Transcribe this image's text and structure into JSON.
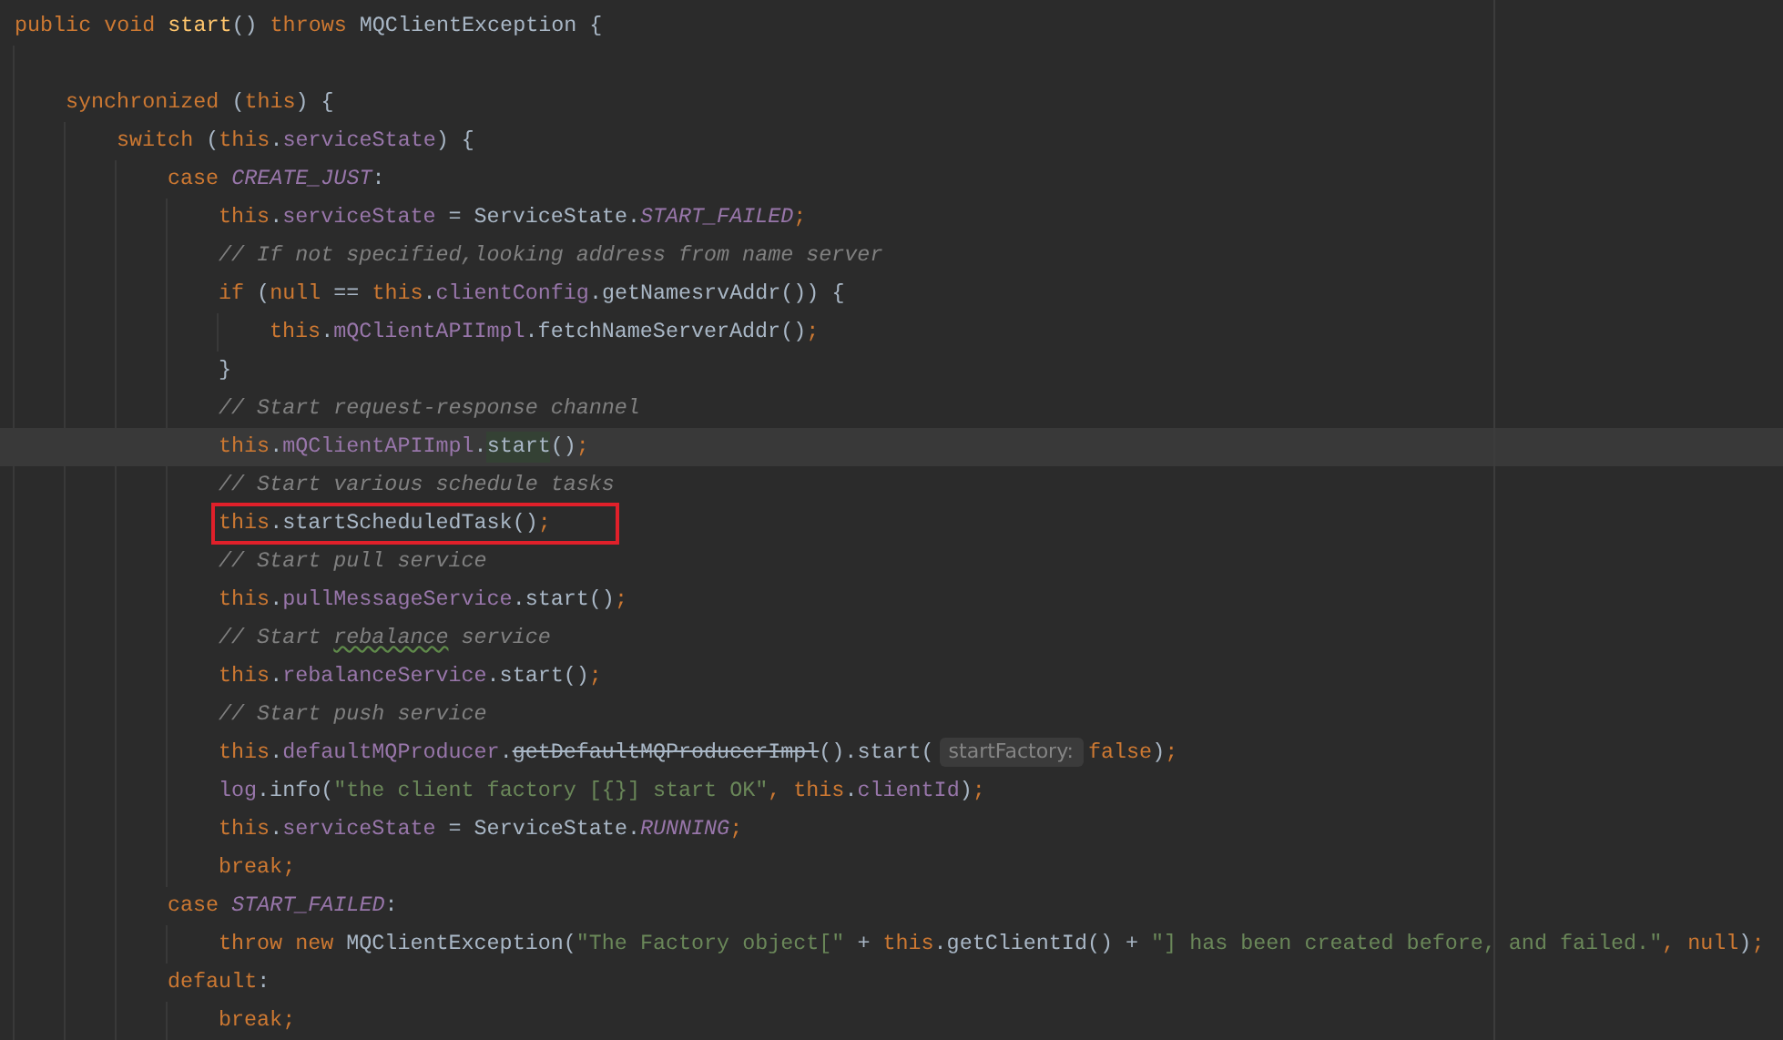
{
  "editor": {
    "lines": [
      {
        "tokens": [
          {
            "kind": "keyword",
            "text": "public void "
          },
          {
            "kind": "declaration",
            "text": "start"
          },
          {
            "kind": "plain",
            "text": "() "
          },
          {
            "kind": "keyword",
            "text": "throws "
          },
          {
            "kind": "plain",
            "text": "MQClientException {"
          }
        ],
        "children": [
          {
            "tokens": [
              {
                "kind": "keyword",
                "text": "synchronized "
              },
              {
                "kind": "plain",
                "text": "("
              },
              {
                "kind": "keyword",
                "text": "this"
              },
              {
                "kind": "plain",
                "text": ") {"
              }
            ],
            "children": [
              {
                "tokens": [
                  {
                    "kind": "keyword",
                    "text": "switch "
                  },
                  {
                    "kind": "plain",
                    "text": "("
                  },
                  {
                    "kind": "keyword",
                    "text": "this"
                  },
                  {
                    "kind": "plain",
                    "text": "."
                  },
                  {
                    "kind": "field",
                    "text": "serviceState"
                  },
                  {
                    "kind": "plain",
                    "text": ") {"
                  }
                ],
                "children": [
                  {
                    "tokens": [
                      {
                        "kind": "keyword",
                        "text": "case "
                      },
                      {
                        "kind": "constant",
                        "text": "CREATE_JUST"
                      },
                      {
                        "kind": "plain",
                        "text": ":"
                      }
                    ],
                    "children": [
                      {
                        "tokens": [
                          {
                            "kind": "keyword",
                            "text": "this"
                          },
                          {
                            "kind": "plain",
                            "text": "."
                          },
                          {
                            "kind": "field",
                            "text": "serviceState"
                          },
                          {
                            "kind": "plain",
                            "text": " = ServiceState."
                          },
                          {
                            "kind": "constant",
                            "text": "START_FAILED"
                          },
                          {
                            "kind": "keyword",
                            "text": ";"
                          }
                        ]
                      },
                      {
                        "tokens": [
                          {
                            "kind": "comment",
                            "text": "// If not specified,looking address from name server"
                          }
                        ]
                      },
                      {
                        "tokens": [
                          {
                            "kind": "keyword",
                            "text": "if "
                          },
                          {
                            "kind": "plain",
                            "text": "("
                          },
                          {
                            "kind": "keyword",
                            "text": "null "
                          },
                          {
                            "kind": "plain",
                            "text": "== "
                          },
                          {
                            "kind": "keyword",
                            "text": "this"
                          },
                          {
                            "kind": "plain",
                            "text": "."
                          },
                          {
                            "kind": "field",
                            "text": "clientConfig"
                          },
                          {
                            "kind": "plain",
                            "text": ".getNamesrvAddr()) {"
                          }
                        ],
                        "children": [
                          {
                            "tokens": [
                              {
                                "kind": "keyword",
                                "text": "this"
                              },
                              {
                                "kind": "plain",
                                "text": "."
                              },
                              {
                                "kind": "field",
                                "text": "mQClientAPIImpl"
                              },
                              {
                                "kind": "plain",
                                "text": ".fetchNameServerAddr()"
                              },
                              {
                                "kind": "keyword",
                                "text": ";"
                              }
                            ]
                          }
                        ]
                      },
                      {
                        "tokens": [
                          {
                            "kind": "plain",
                            "text": "}"
                          }
                        ]
                      },
                      {
                        "tokens": [
                          {
                            "kind": "comment",
                            "text": "// Start request-response channel"
                          }
                        ]
                      },
                      {
                        "current": true,
                        "tokens": [
                          {
                            "kind": "keyword",
                            "text": "this"
                          },
                          {
                            "kind": "plain",
                            "text": "."
                          },
                          {
                            "kind": "field",
                            "text": "mQClientAPIImpl"
                          },
                          {
                            "kind": "plain",
                            "text": "."
                          },
                          {
                            "kind": "match",
                            "text": "start"
                          },
                          {
                            "kind": "plain",
                            "text": "()"
                          },
                          {
                            "kind": "keyword",
                            "text": ";"
                          }
                        ]
                      },
                      {
                        "tokens": [
                          {
                            "kind": "comment",
                            "text": "// Start various schedule tasks"
                          }
                        ]
                      },
                      {
                        "boxed": true,
                        "tokens": [
                          {
                            "kind": "keyword",
                            "text": "this"
                          },
                          {
                            "kind": "plain",
                            "text": ".startScheduledTask()"
                          },
                          {
                            "kind": "keyword",
                            "text": ";"
                          }
                        ]
                      },
                      {
                        "tokens": [
                          {
                            "kind": "comment",
                            "text": "// Start pull service"
                          }
                        ]
                      },
                      {
                        "tokens": [
                          {
                            "kind": "keyword",
                            "text": "this"
                          },
                          {
                            "kind": "plain",
                            "text": "."
                          },
                          {
                            "kind": "field",
                            "text": "pullMessageService"
                          },
                          {
                            "kind": "plain",
                            "text": ".start()"
                          },
                          {
                            "kind": "keyword",
                            "text": ";"
                          }
                        ]
                      },
                      {
                        "tokens": [
                          {
                            "kind": "comment",
                            "text": "// Start "
                          },
                          {
                            "kind": "typo",
                            "text": "rebalance"
                          },
                          {
                            "kind": "comment",
                            "text": " service"
                          }
                        ]
                      },
                      {
                        "tokens": [
                          {
                            "kind": "keyword",
                            "text": "this"
                          },
                          {
                            "kind": "plain",
                            "text": "."
                          },
                          {
                            "kind": "field",
                            "text": "rebalanceService"
                          },
                          {
                            "kind": "plain",
                            "text": ".start()"
                          },
                          {
                            "kind": "keyword",
                            "text": ";"
                          }
                        ]
                      },
                      {
                        "tokens": [
                          {
                            "kind": "comment",
                            "text": "// Start push service"
                          }
                        ]
                      },
                      {
                        "tokens": [
                          {
                            "kind": "keyword",
                            "text": "this"
                          },
                          {
                            "kind": "plain",
                            "text": "."
                          },
                          {
                            "kind": "field",
                            "text": "defaultMQProducer"
                          },
                          {
                            "kind": "plain",
                            "text": "."
                          },
                          {
                            "kind": "deprecated",
                            "text": "getDefaultMQProducerImpl"
                          },
                          {
                            "kind": "plain",
                            "text": "().start("
                          },
                          {
                            "kind": "hint",
                            "text": "startFactory:"
                          },
                          {
                            "kind": "keyword",
                            "text": "false"
                          },
                          {
                            "kind": "plain",
                            "text": ")"
                          },
                          {
                            "kind": "keyword",
                            "text": ";"
                          }
                        ]
                      },
                      {
                        "tokens": [
                          {
                            "kind": "field",
                            "text": "log"
                          },
                          {
                            "kind": "plain",
                            "text": ".info("
                          },
                          {
                            "kind": "string",
                            "text": "\"the client factory [{}] start OK\""
                          },
                          {
                            "kind": "keyword",
                            "text": ", this"
                          },
                          {
                            "kind": "plain",
                            "text": "."
                          },
                          {
                            "kind": "field",
                            "text": "clientId"
                          },
                          {
                            "kind": "plain",
                            "text": ")"
                          },
                          {
                            "kind": "keyword",
                            "text": ";"
                          }
                        ]
                      },
                      {
                        "tokens": [
                          {
                            "kind": "keyword",
                            "text": "this"
                          },
                          {
                            "kind": "plain",
                            "text": "."
                          },
                          {
                            "kind": "field",
                            "text": "serviceState"
                          },
                          {
                            "kind": "plain",
                            "text": " = ServiceState."
                          },
                          {
                            "kind": "constant",
                            "text": "RUNNING"
                          },
                          {
                            "kind": "keyword",
                            "text": ";"
                          }
                        ]
                      },
                      {
                        "tokens": [
                          {
                            "kind": "keyword",
                            "text": "break;"
                          }
                        ]
                      }
                    ]
                  },
                  {
                    "tokens": [
                      {
                        "kind": "keyword",
                        "text": "case "
                      },
                      {
                        "kind": "constant",
                        "text": "START_FAILED"
                      },
                      {
                        "kind": "plain",
                        "text": ":"
                      }
                    ],
                    "children": [
                      {
                        "tokens": [
                          {
                            "kind": "keyword",
                            "text": "throw new "
                          },
                          {
                            "kind": "plain",
                            "text": "MQClientException("
                          },
                          {
                            "kind": "string",
                            "text": "\"The Factory object[\""
                          },
                          {
                            "kind": "plain",
                            "text": " + "
                          },
                          {
                            "kind": "keyword",
                            "text": "this"
                          },
                          {
                            "kind": "plain",
                            "text": ".getClientId() + "
                          },
                          {
                            "kind": "string",
                            "text": "\"] has been created before, and failed.\""
                          },
                          {
                            "kind": "keyword",
                            "text": ", null"
                          },
                          {
                            "kind": "plain",
                            "text": ")"
                          },
                          {
                            "kind": "keyword",
                            "text": ";"
                          }
                        ]
                      }
                    ]
                  },
                  {
                    "tokens": [
                      {
                        "kind": "keyword",
                        "text": "default"
                      },
                      {
                        "kind": "plain",
                        "text": ":"
                      }
                    ],
                    "children": [
                      {
                        "tokens": [
                          {
                            "kind": "keyword",
                            "text": "break;"
                          }
                        ]
                      }
                    ]
                  }
                ]
              }
            ]
          }
        ]
      }
    ]
  }
}
